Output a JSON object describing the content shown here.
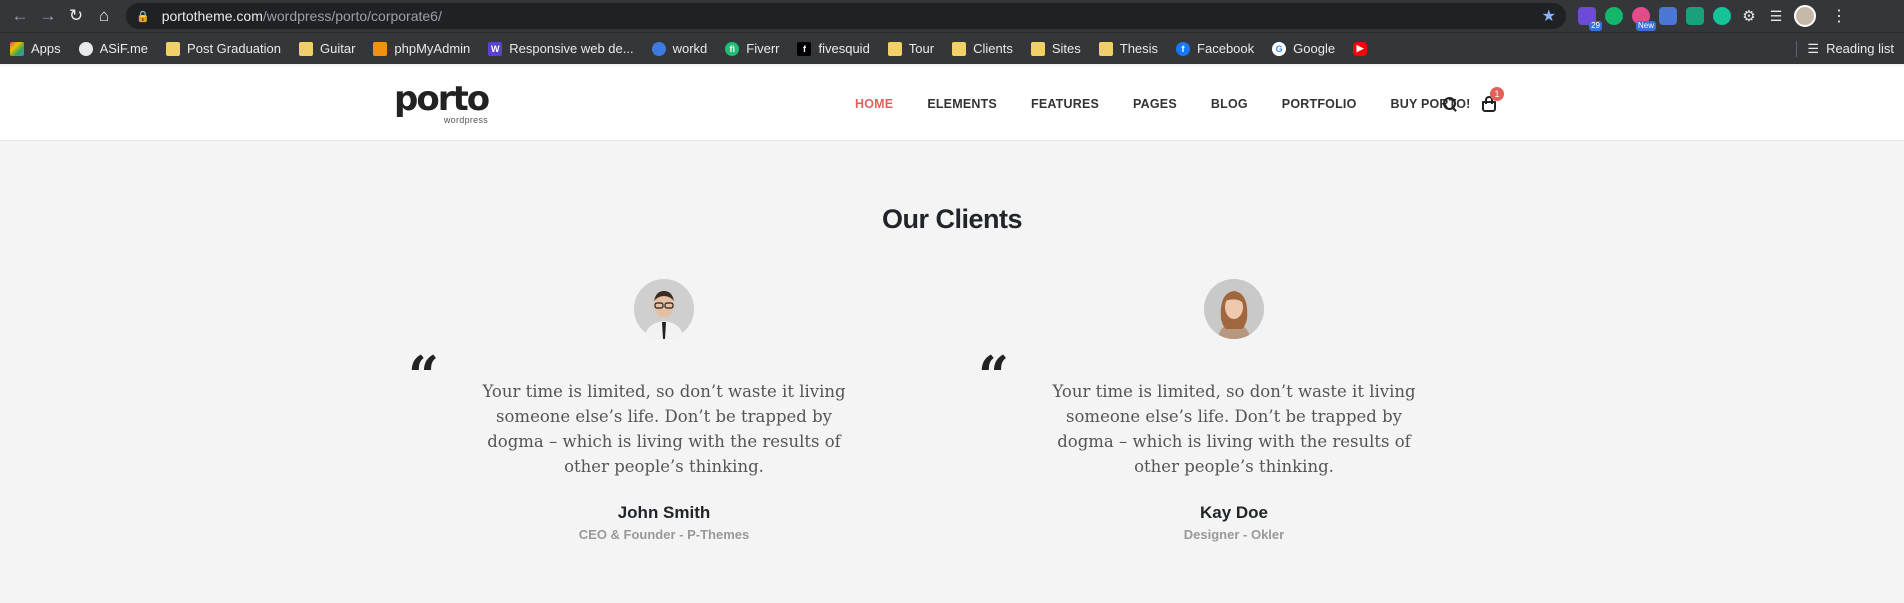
{
  "browser": {
    "url_host": "portotheme.com",
    "url_path": "/wordpress/porto/corporate6/",
    "extensions": [
      {
        "name": "ext-badge-29",
        "badge": "29",
        "color": "#6b4bd8"
      },
      {
        "name": "ext-green",
        "badge": "",
        "color": "#12b76a"
      },
      {
        "name": "ext-new",
        "badge": "New",
        "color": "#e44b8d"
      },
      {
        "name": "ext-pen",
        "badge": "",
        "color": "#4a76d4"
      },
      {
        "name": "ext-leaf",
        "badge": "",
        "color": "#18a07a"
      },
      {
        "name": "ext-grammarly",
        "badge": "",
        "color": "#15c39a"
      }
    ],
    "bookmarks": [
      {
        "label": "Apps",
        "icon": "apps-grid-icon"
      },
      {
        "label": "ASiF.me",
        "icon": "globe-icon"
      },
      {
        "label": "Post Graduation",
        "icon": "folder-icon"
      },
      {
        "label": "Guitar",
        "icon": "folder-icon"
      },
      {
        "label": "phpMyAdmin",
        "icon": "phpmyadmin-icon"
      },
      {
        "label": "Responsive web de...",
        "icon": "w-icon"
      },
      {
        "label": "workd",
        "icon": "workd-icon"
      },
      {
        "label": "Fiverr",
        "icon": "fiverr-icon"
      },
      {
        "label": "fivesquid",
        "icon": "f-icon"
      },
      {
        "label": "Tour",
        "icon": "folder-icon"
      },
      {
        "label": "Clients",
        "icon": "folder-icon"
      },
      {
        "label": "Sites",
        "icon": "folder-icon"
      },
      {
        "label": "Thesis",
        "icon": "folder-icon"
      },
      {
        "label": "Facebook",
        "icon": "facebook-icon"
      },
      {
        "label": "Google",
        "icon": "google-icon"
      },
      {
        "label": "",
        "icon": "youtube-icon"
      }
    ],
    "reading_list": "Reading list"
  },
  "site": {
    "logo_text": "porto",
    "logo_sub": "wordpress",
    "menu": [
      "HOME",
      "ELEMENTS",
      "FEATURES",
      "PAGES",
      "BLOG",
      "PORTFOLIO",
      "BUY PORTO!"
    ],
    "cart_count": "1",
    "accent_color": "#e36159"
  },
  "section": {
    "title_light": "Our",
    "title_bold": "Clients"
  },
  "testimonials": [
    {
      "quote": "Your time is limited, so don’t waste it living someone else’s life. Don’t be trapped by dogma – which is living with the results of other people’s thinking.",
      "name": "John Smith",
      "role": "CEO & Founder - P-Themes"
    },
    {
      "quote": "Your time is limited, so don’t waste it living someone else’s life. Don’t be trapped by dogma – which is living with the results of other people’s thinking.",
      "name": "Kay Doe",
      "role": "Designer - Okler"
    }
  ]
}
